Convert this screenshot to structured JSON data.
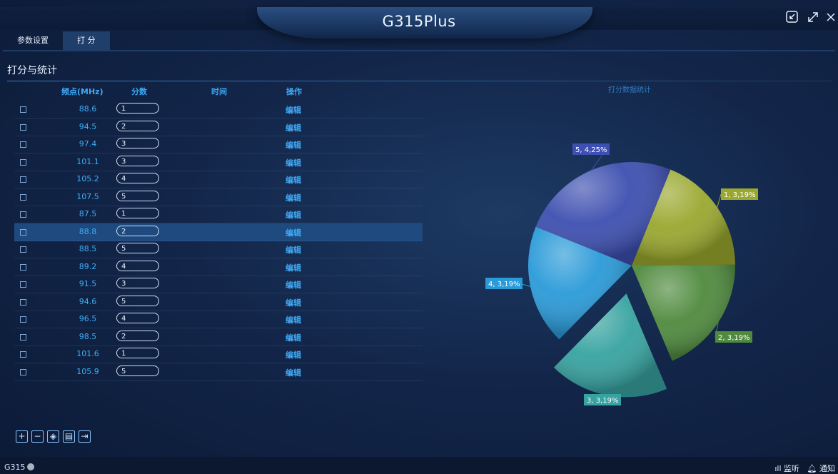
{
  "app": {
    "title": "G315Plus"
  },
  "window": {
    "collapse_icon": "collapse-icon",
    "maximize_icon": "maximize-icon",
    "close_icon": "close-icon"
  },
  "tabs": [
    {
      "label": "参数设置",
      "active": false
    },
    {
      "label": "打 分",
      "active": true
    }
  ],
  "panel": {
    "title": "打分与统计"
  },
  "table": {
    "headers": {
      "freq": "频点(MHz)",
      "score": "分数",
      "time": "时间",
      "action": "操作"
    },
    "edit_label": "编辑",
    "selected_index": 7,
    "rows": [
      {
        "freq": "88.6",
        "score": "1"
      },
      {
        "freq": "94.5",
        "score": "2"
      },
      {
        "freq": "97.4",
        "score": "3"
      },
      {
        "freq": "101.1",
        "score": "3"
      },
      {
        "freq": "105.2",
        "score": "4"
      },
      {
        "freq": "107.5",
        "score": "5"
      },
      {
        "freq": "87.5",
        "score": "1"
      },
      {
        "freq": "88.8",
        "score": "2"
      },
      {
        "freq": "88.5",
        "score": "5"
      },
      {
        "freq": "89.2",
        "score": "4"
      },
      {
        "freq": "91.5",
        "score": "3"
      },
      {
        "freq": "94.6",
        "score": "5"
      },
      {
        "freq": "96.5",
        "score": "4"
      },
      {
        "freq": "98.5",
        "score": "2"
      },
      {
        "freq": "101.6",
        "score": "1"
      },
      {
        "freq": "105.9",
        "score": "5"
      }
    ]
  },
  "chart_title": "打分数据统计",
  "chart_data": {
    "type": "pie",
    "slices": [
      {
        "label": "1, 3,19%",
        "score": 1,
        "count": 3,
        "percent": 19,
        "color": "#9aa82f"
      },
      {
        "label": "2, 3,19%",
        "score": 2,
        "count": 3,
        "percent": 19,
        "color": "#4f8a3e"
      },
      {
        "label": "3, 3,19%",
        "score": 3,
        "count": 3,
        "percent": 19,
        "color": "#37a3a0"
      },
      {
        "label": "4, 3,19%",
        "score": 4,
        "count": 3,
        "percent": 19,
        "color": "#2a9ad8"
      },
      {
        "label": "5, 4,25%",
        "score": 5,
        "count": 4,
        "percent": 25,
        "color": "#3d4fb0"
      }
    ]
  },
  "toolbar": {
    "buttons": [
      {
        "name": "add-button",
        "icon": "plus-icon",
        "glyph": "+"
      },
      {
        "name": "remove-button",
        "icon": "minus-icon",
        "glyph": "−"
      },
      {
        "name": "clear-button",
        "icon": "eraser-icon",
        "glyph": "◈"
      },
      {
        "name": "import-button",
        "icon": "import-icon",
        "glyph": "▤"
      },
      {
        "name": "export-button",
        "icon": "export-icon",
        "glyph": "⇥"
      }
    ]
  },
  "footer": {
    "left_label": "G315",
    "listen_label": "监听",
    "notify_label": "通知"
  }
}
